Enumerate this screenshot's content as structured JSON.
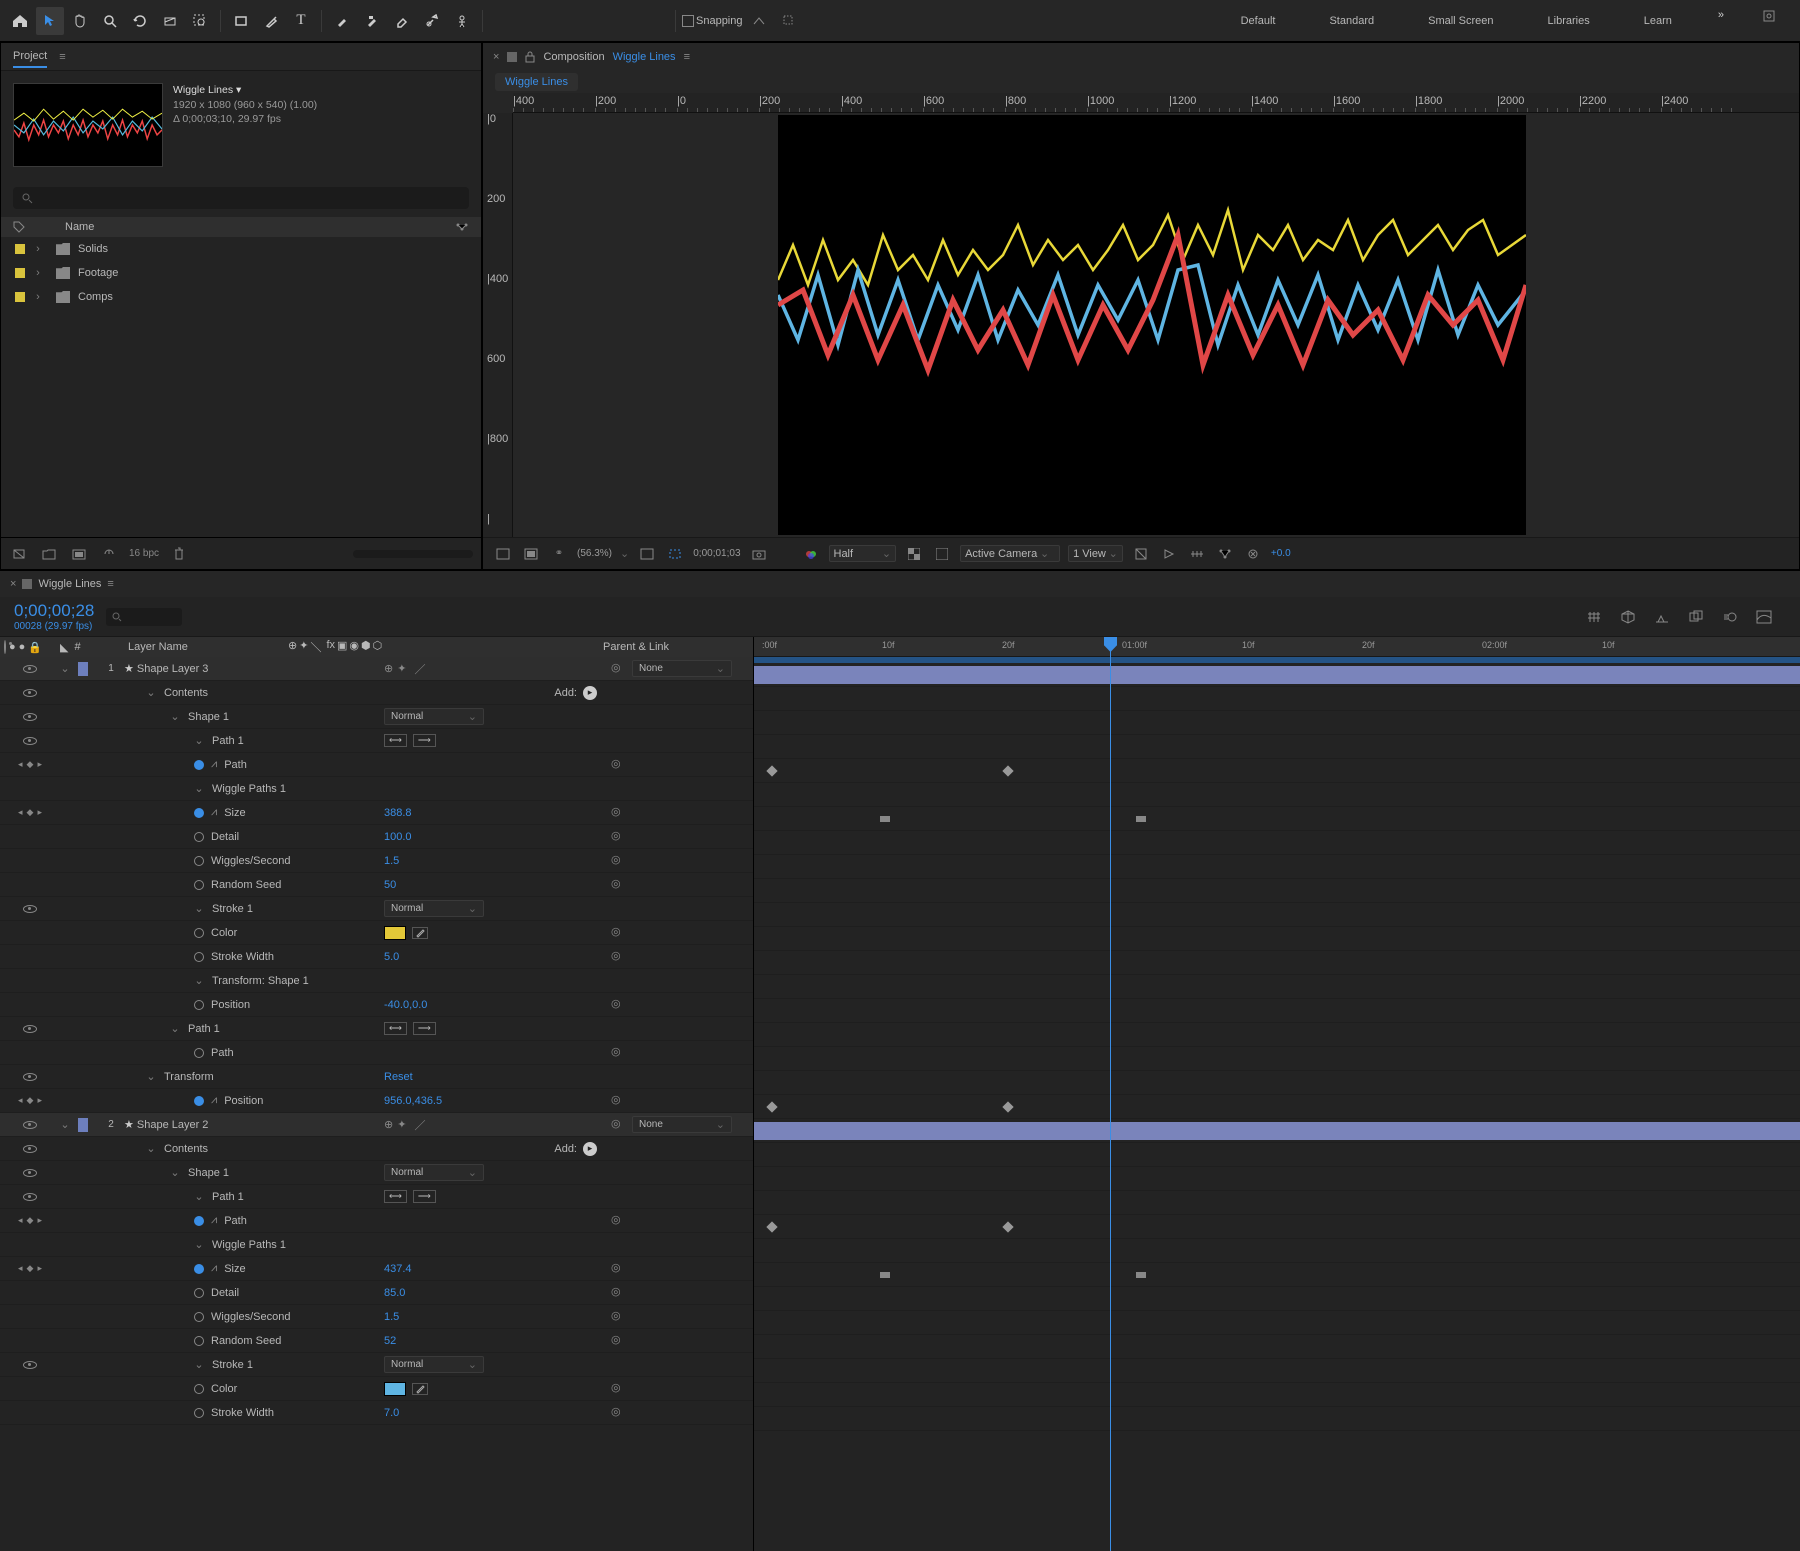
{
  "toolbar": {
    "snapping": "Snapping",
    "workspaces": [
      "Default",
      "Standard",
      "Small Screen",
      "Libraries",
      "Learn"
    ]
  },
  "project": {
    "tab": "Project",
    "comp_name": "Wiggle Lines ▾",
    "comp_res": "1920 x 1080   (960 x 540) (1.00)",
    "comp_time": "Δ 0;00;03;10, 29.97 fps",
    "name_col": "Name",
    "tree": [
      {
        "name": "Solids"
      },
      {
        "name": "Footage"
      },
      {
        "name": "Comps"
      }
    ],
    "bpc": "16 bpc"
  },
  "viewer": {
    "comp_label": "Composition",
    "comp_name": "Wiggle Lines",
    "flow_name": "Wiggle Lines",
    "zoom": "(56.3%)",
    "time": "0;00;01;03",
    "res": "Half",
    "camera": "Active Camera",
    "view": "1 View",
    "exposure": "+0.0",
    "h_ruler": [
      "|400",
      "|200",
      "|0",
      "|200",
      "|400",
      "|600",
      "|800",
      "|1000",
      "|1200",
      "|1400",
      "|1600",
      "|1800",
      "|2000",
      "|2200",
      "|2400"
    ],
    "v_ruler": [
      "|0",
      "200",
      "|400",
      "600",
      "|800",
      "|"
    ]
  },
  "timeline": {
    "tab": "Wiggle Lines",
    "tc": "0;00;00;28",
    "tc_small": "00028 (29.97 fps)",
    "col_num": "#",
    "col_name": "Layer Name",
    "col_parent": "Parent & Link",
    "ruler": [
      ":00f",
      "10f",
      "20f",
      "01:00f",
      "10f",
      "20f",
      "02:00f",
      "10f"
    ],
    "layers": [
      {
        "num": "1",
        "name": "Shape Layer 3",
        "color": "#6d7fbd",
        "parent": "None",
        "sub": [
          {
            "label": "Contents",
            "add": "Add:",
            "indent": 1,
            "tw": "⌄"
          },
          {
            "label": "Shape 1",
            "mode": "Normal",
            "indent": 2,
            "tw": "⌄"
          },
          {
            "label": "Path 1",
            "indent": 3,
            "tw": "⌄",
            "pathbtn": true
          },
          {
            "label": "Path",
            "indent": 3,
            "stop": "on",
            "kf": true,
            "graph": true,
            "pick": true
          },
          {
            "label": "Wiggle Paths 1",
            "indent": 3,
            "tw": "⌄"
          },
          {
            "label": "Size",
            "val": "388.8",
            "indent": 3,
            "stop": "on",
            "graph": true,
            "pick": true,
            "hold": true
          },
          {
            "label": "Detail",
            "val": "100.0",
            "indent": 3,
            "stop": "off",
            "pick": true
          },
          {
            "label": "Wiggles/Second",
            "val": "1.5",
            "indent": 3,
            "stop": "off",
            "pick": true
          },
          {
            "label": "Random Seed",
            "val": "50",
            "indent": 3,
            "stop": "off",
            "pick": true
          },
          {
            "label": "Stroke 1",
            "mode": "Normal",
            "indent": 3,
            "tw": "⌄"
          },
          {
            "label": "Color",
            "swatch": "#e3c838",
            "indent": 3,
            "stop": "off",
            "pick": true,
            "boxed": true
          },
          {
            "label": "Stroke Width",
            "val": "5.0",
            "indent": 3,
            "stop": "off",
            "pick": true
          },
          {
            "label": "Transform: Shape 1",
            "indent": 3,
            "tw": "⌄"
          },
          {
            "label": "Position",
            "val": "-40.0,0.0",
            "indent": 3,
            "stop": "off",
            "pick": true
          },
          {
            "label": "Path 1",
            "indent": 2,
            "tw": "⌄",
            "pathbtn": true
          },
          {
            "label": "Path",
            "indent": 3,
            "stop": "off",
            "pick": true
          },
          {
            "label": "Transform",
            "reset": "Reset",
            "indent": 1,
            "tw": "⌄"
          },
          {
            "label": "Position",
            "val": "956.0,436.5",
            "indent": 3,
            "stop": "on",
            "graph": true,
            "kf": true,
            "pick": true
          }
        ]
      },
      {
        "num": "2",
        "name": "Shape Layer 2",
        "color": "#6d7fbd",
        "parent": "None",
        "sub": [
          {
            "label": "Contents",
            "add": "Add:",
            "indent": 1,
            "tw": "⌄"
          },
          {
            "label": "Shape 1",
            "mode": "Normal",
            "indent": 2,
            "tw": "⌄"
          },
          {
            "label": "Path 1",
            "indent": 3,
            "tw": "⌄",
            "pathbtn": true
          },
          {
            "label": "Path",
            "indent": 3,
            "stop": "on",
            "kf": true,
            "graph": true,
            "pick": true
          },
          {
            "label": "Wiggle Paths 1",
            "indent": 3,
            "tw": "⌄"
          },
          {
            "label": "Size",
            "val": "437.4",
            "indent": 3,
            "stop": "on",
            "graph": true,
            "pick": true,
            "hold": true
          },
          {
            "label": "Detail",
            "val": "85.0",
            "indent": 3,
            "stop": "off",
            "pick": true
          },
          {
            "label": "Wiggles/Second",
            "val": "1.5",
            "indent": 3,
            "stop": "off",
            "pick": true
          },
          {
            "label": "Random Seed",
            "val": "52",
            "indent": 3,
            "stop": "off",
            "pick": true
          },
          {
            "label": "Stroke 1",
            "mode": "Normal",
            "indent": 3,
            "tw": "⌄"
          },
          {
            "label": "Color",
            "swatch": "#5fb5e3",
            "indent": 3,
            "stop": "off",
            "pick": true,
            "boxed": true
          },
          {
            "label": "Stroke Width",
            "val": "7.0",
            "indent": 3,
            "stop": "off",
            "pick": true
          }
        ]
      }
    ]
  }
}
